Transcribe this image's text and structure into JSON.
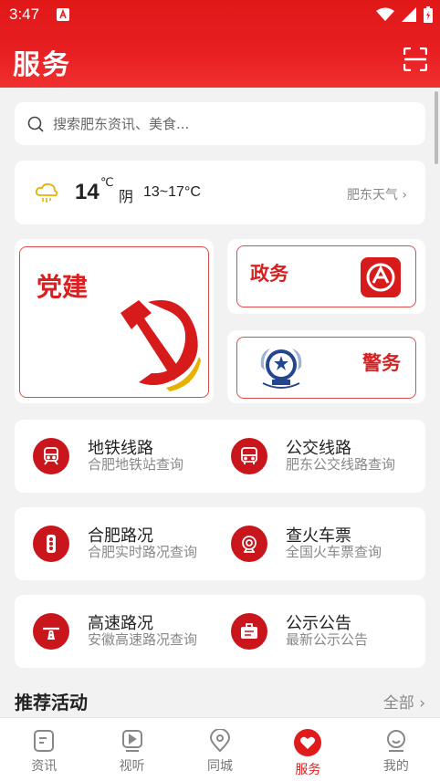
{
  "status_bar": {
    "time": "3:47"
  },
  "header": {
    "title": "服务"
  },
  "search": {
    "placeholder": "搜索肥东资讯、美食..."
  },
  "weather": {
    "temp": "14",
    "unit": "℃",
    "condition": "阴",
    "range": "13~17°C",
    "link": "肥东天气 ›"
  },
  "features": {
    "party": "党建",
    "gov": "政务",
    "police": "警务"
  },
  "services": [
    {
      "title": "地铁线路",
      "subtitle": "合肥地铁站查询",
      "icon": "train-icon"
    },
    {
      "title": "公交线路",
      "subtitle": "肥东公交线路查询",
      "icon": "bus-icon"
    },
    {
      "title": "合肥路况",
      "subtitle": "合肥实时路况查询",
      "icon": "traffic-light-icon"
    },
    {
      "title": "查火车票",
      "subtitle": "全国火车票查询",
      "icon": "rail-ticket-icon"
    },
    {
      "title": "高速路况",
      "subtitle": "安徽高速路况查询",
      "icon": "highway-icon"
    },
    {
      "title": "公示公告",
      "subtitle": "最新公示公告",
      "icon": "notice-icon"
    }
  ],
  "section": {
    "title": "推荐活动",
    "more": "全部 ›"
  },
  "tabs": [
    {
      "label": "资讯",
      "icon": "news-icon",
      "active": false
    },
    {
      "label": "视听",
      "icon": "video-icon",
      "active": false
    },
    {
      "label": "同城",
      "icon": "location-icon",
      "active": false
    },
    {
      "label": "服务",
      "icon": "heart-icon",
      "active": true
    },
    {
      "label": "我的",
      "icon": "profile-icon",
      "active": false
    }
  ],
  "colors": {
    "brand_red": "#d92020",
    "header_red": "#e81f22",
    "icon_red": "#c9161d"
  }
}
